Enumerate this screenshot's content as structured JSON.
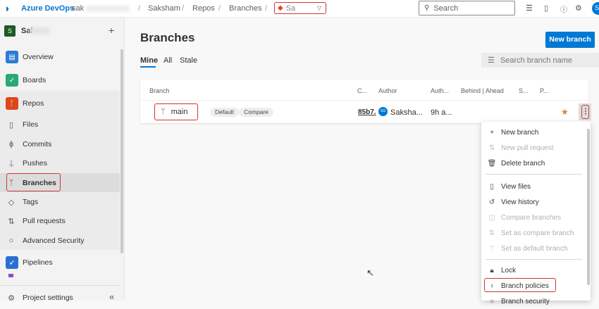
{
  "topbar": {
    "brand": "Azure DevOps",
    "org": "sak",
    "crumbs": [
      "Saksham",
      "Repos",
      "Branches"
    ],
    "repo": "Sa",
    "search_placeholder": "Search",
    "avatar": "S"
  },
  "sidebar": {
    "project_initial": "S",
    "project_name": "Sal",
    "add": "+",
    "items": [
      {
        "label": "Overview"
      },
      {
        "label": "Boards"
      },
      {
        "label": "Repos"
      },
      {
        "label": "Files"
      },
      {
        "label": "Commits"
      },
      {
        "label": "Pushes"
      },
      {
        "label": "Branches"
      },
      {
        "label": "Tags"
      },
      {
        "label": "Pull requests"
      },
      {
        "label": "Advanced Security"
      },
      {
        "label": "Pipelines"
      }
    ],
    "settings": "Project settings",
    "collapse": "«"
  },
  "main": {
    "title": "Branches",
    "new_branch": "New branch",
    "tabs": [
      "Mine",
      "All",
      "Stale"
    ],
    "search_placeholder": "Search branch name",
    "columns": [
      "Branch",
      "C...",
      "Author",
      "Auth...",
      "Behind | Ahead",
      "S...",
      "P..."
    ],
    "row": {
      "name": "main",
      "default": "Default",
      "compare": "Compare",
      "commit": "85b7.",
      "author_initials": "SG",
      "author": "Saksha...",
      "time": "9h a..."
    }
  },
  "menu": {
    "items": [
      "New branch",
      "New pull request",
      "Delete branch",
      "View files",
      "View history",
      "Compare branches",
      "Set as compare branch",
      "Set as default branch",
      "Lock",
      "Branch policies",
      "Branch security"
    ]
  },
  "colors": {
    "accent": "#0078d4",
    "highlight": "#d13438",
    "star": "#e8762d"
  }
}
